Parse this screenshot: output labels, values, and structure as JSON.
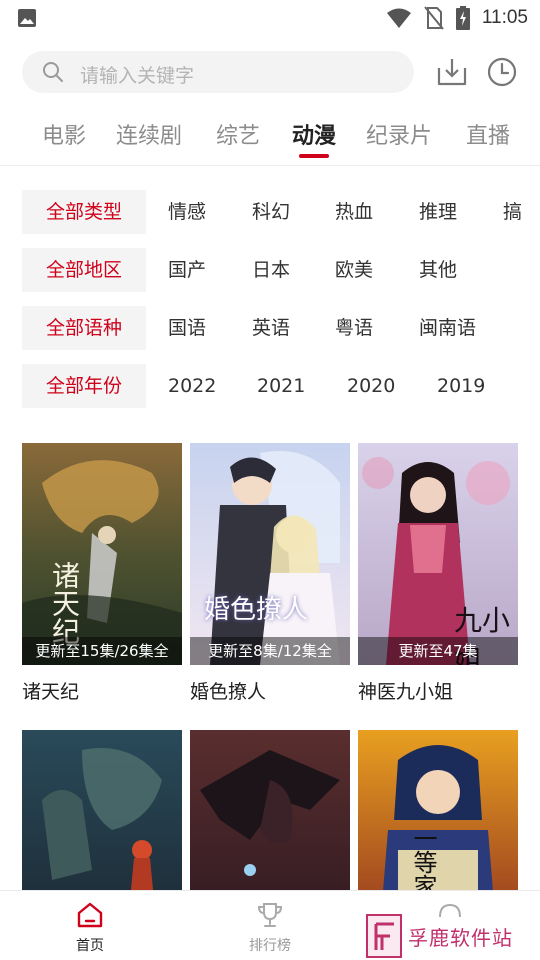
{
  "status_bar": {
    "time": "11:05"
  },
  "search": {
    "placeholder": "请输入关键字"
  },
  "tabs": [
    {
      "label": "电影"
    },
    {
      "label": "连续剧"
    },
    {
      "label": "综艺"
    },
    {
      "label": "动漫"
    },
    {
      "label": "纪录片"
    },
    {
      "label": "直播"
    }
  ],
  "active_tab_index": 3,
  "filters": [
    {
      "all": "全部类型",
      "options": [
        "情感",
        "科幻",
        "热血",
        "推理",
        "搞"
      ]
    },
    {
      "all": "全部地区",
      "options": [
        "国产",
        "日本",
        "欧美",
        "其他"
      ]
    },
    {
      "all": "全部语种",
      "options": [
        "国语",
        "英语",
        "粤语",
        "闽南语"
      ]
    },
    {
      "all": "全部年份",
      "options": [
        "2022",
        "2021",
        "2020",
        "2019"
      ]
    }
  ],
  "cards": [
    {
      "title": "诸天纪",
      "update": "更新至15集/26集全",
      "poster_text": "诸天纪"
    },
    {
      "title": "婚色撩人",
      "update": "更新至8集/12集全",
      "poster_text": "婚色撩人"
    },
    {
      "title": "神医九小姐",
      "update": "更新至47集",
      "poster_text": "九小姐"
    },
    {
      "title": "",
      "update": "",
      "poster_text": ""
    },
    {
      "title": "",
      "update": "",
      "poster_text": ""
    },
    {
      "title": "",
      "update": "",
      "poster_text": "一等家丁"
    }
  ],
  "bottom_nav": [
    {
      "label": "首页",
      "icon": "home-icon"
    },
    {
      "label": "排行榜",
      "icon": "trophy-icon"
    },
    {
      "label": "",
      "icon": "profile-icon"
    }
  ],
  "watermark": {
    "text": "孚鹿软件站"
  },
  "colors": {
    "accent": "#d0021b",
    "watermark": "#c0306a"
  }
}
